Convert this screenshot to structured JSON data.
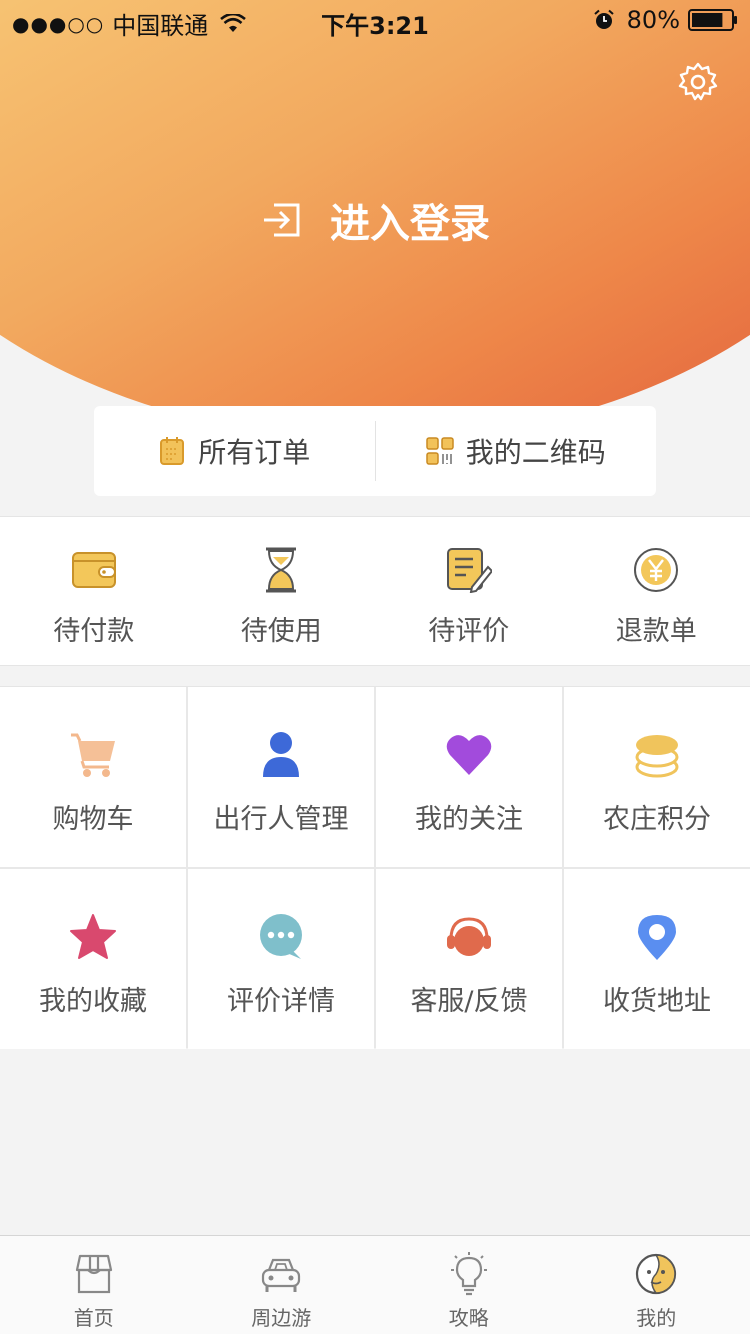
{
  "status_bar": {
    "signal": "●●●○○",
    "carrier": "中国联通",
    "time": "下午3:21",
    "battery": "80%",
    "battery_level": 0.8
  },
  "header": {
    "login_label": "进入登录"
  },
  "orders": {
    "all_orders": "所有订单",
    "my_qrcode": "我的二维码"
  },
  "status_items": [
    {
      "label": "待付款",
      "icon": "wallet-icon"
    },
    {
      "label": "待使用",
      "icon": "hourglass-icon"
    },
    {
      "label": "待评价",
      "icon": "review-icon"
    },
    {
      "label": "退款单",
      "icon": "yen-icon"
    }
  ],
  "grid_items": [
    {
      "label": "购物车",
      "icon": "cart-icon"
    },
    {
      "label": "出行人管理",
      "icon": "person-icon"
    },
    {
      "label": "我的关注",
      "icon": "heart-icon"
    },
    {
      "label": "农庄积分",
      "icon": "coins-icon"
    },
    {
      "label": "我的收藏",
      "icon": "star-icon"
    },
    {
      "label": "评价详情",
      "icon": "chat-icon"
    },
    {
      "label": "客服/反馈",
      "icon": "headset-icon"
    },
    {
      "label": "收货地址",
      "icon": "location-icon"
    }
  ],
  "tabs": [
    {
      "label": "首页",
      "icon": "home-store-icon"
    },
    {
      "label": "周边游",
      "icon": "car-icon"
    },
    {
      "label": "攻略",
      "icon": "bulb-icon"
    },
    {
      "label": "我的",
      "icon": "face-icon"
    }
  ],
  "colors": {
    "gradient_start": "#fbe78c",
    "gradient_end": "#e0583a",
    "accent_gold": "#e9b24a",
    "person_blue": "#3d69d8",
    "heart_purple": "#a24bdc",
    "star_pink": "#d9496e",
    "chat_teal": "#7fbfcb",
    "headset_orange": "#e06a4c",
    "location_blue": "#5a8ef0"
  }
}
